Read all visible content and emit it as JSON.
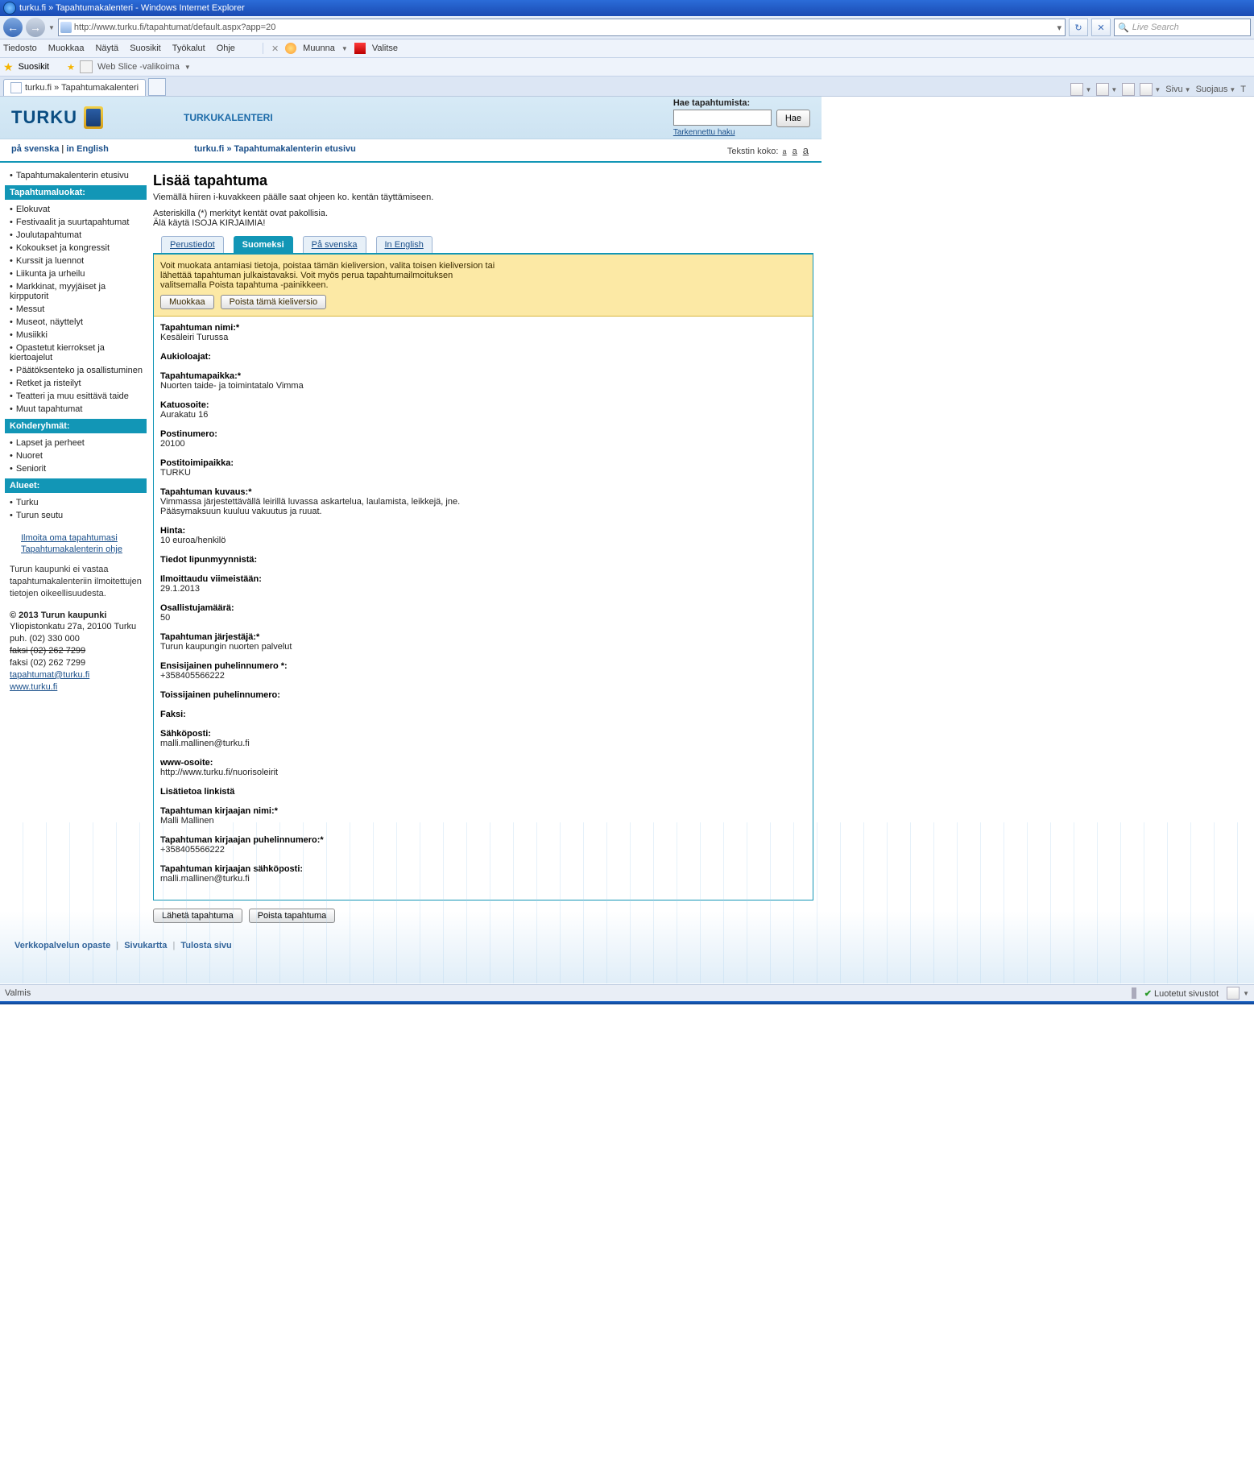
{
  "window": {
    "title": "turku.fi » Tapahtumakalenteri - Windows Internet Explorer",
    "url": "http://www.turku.fi/tapahtumat/default.aspx?app=20",
    "search_placeholder": "Live Search",
    "status_left": "Valmis",
    "status_trusted": "Luotetut sivustot"
  },
  "menus": {
    "items": [
      "Tiedosto",
      "Muokkaa",
      "Näytä",
      "Suosikit",
      "Työkalut",
      "Ohje"
    ],
    "muunna": "Muunna",
    "valitse": "Valitse",
    "favorites_label": "Suosikit",
    "webslice": "Web Slice -valikoima",
    "tab_label": "turku.fi » Tapahtumakalenteri",
    "tools": {
      "sivu": "Sivu",
      "suojaus": "Suojaus",
      "t": "T"
    }
  },
  "header": {
    "logo_text": "TURKU",
    "site_title": "TURKUKALENTERI",
    "search_label": "Hae tapahtumista:",
    "search_btn": "Hae",
    "adv_link": "Tarkennettu haku"
  },
  "subheader": {
    "lang_sv": "på svenska",
    "lang_en": "in English",
    "breadcrumb": "turku.fi » Tapahtumakalenterin etusivu",
    "text_size_label": "Tekstin koko:"
  },
  "sidebar": {
    "top_link": "Tapahtumakalenterin etusivu",
    "cat_head": "Tapahtumaluokat:",
    "cats": [
      "Elokuvat",
      "Festivaalit ja suurtapahtumat",
      "Joulutapahtumat",
      "Kokoukset ja kongressit",
      "Kurssit ja luennot",
      "Liikunta ja urheilu",
      "Markkinat, myyjäiset ja kirpputorit",
      "Messut",
      "Museot, näyttelyt",
      "Musiikki",
      "Opastetut kierrokset ja kiertoajelut",
      "Päätöksenteko ja osallistuminen",
      "Retket ja risteilyt",
      "Teatteri ja muu esittävä taide",
      "Muut tapahtumat"
    ],
    "grp_head": "Kohderyhmät:",
    "grps": [
      "Lapset ja perheet",
      "Nuoret",
      "Seniorit"
    ],
    "area_head": "Alueet:",
    "areas": [
      "Turku",
      "Turun seutu"
    ],
    "link1": "Ilmoita oma tapahtumasi",
    "link2": "Tapahtumakalenterin ohje",
    "disclaimer": "Turun kaupunki ei vastaa tapahtumakalenteriin ilmoitettujen tietojen oikeellisuudesta.",
    "copyright": "© 2013 Turun kaupunki",
    "addr": "Yliopistonkatu 27a, 20100 Turku",
    "tel": "puh. (02) 330 000",
    "fax1": "faksi (02) 262 7299",
    "fax2": "faksi (02) 262 7299",
    "email": "tapahtumat@turku.fi",
    "web": "www.turku.fi"
  },
  "main": {
    "h1": "Lisää tapahtuma",
    "intro1": "Viemällä hiiren i-kuvakkeen päälle saat ohjeen ko. kentän täyttämiseen.",
    "intro2": "Asteriskilla (*) merkityt kentät ovat pakollisia.",
    "intro3": "Älä käytä ISOJA KIRJAIMIA!",
    "tabs": {
      "t1": "Perustiedot",
      "t2": "Suomeksi",
      "t3": "På svenska",
      "t4": "In English"
    },
    "notice": {
      "line1": "Voit muokata antamiasi tietoja, poistaa tämän kieliversion, valita toisen kieliversion tai",
      "line2": "lähettää tapahtuman julkaistavaksi. Voit myös perua tapahtumailmoituksen",
      "line3": "valitsemalla Poista tapahtuma -painikkeen.",
      "btn_edit": "Muokkaa",
      "btn_del_lang": "Poista tämä kieliversio"
    },
    "fields": [
      {
        "label": "Tapahtuman nimi:*",
        "value": "Kesäleiri Turussa"
      },
      {
        "label": "Aukioloajat:",
        "value": ""
      },
      {
        "label": "Tapahtumapaikka:*",
        "value": "Nuorten taide- ja toimintatalo Vimma"
      },
      {
        "label": "Katuosoite:",
        "value": "Aurakatu 16"
      },
      {
        "label": "Postinumero:",
        "value": "20100"
      },
      {
        "label": "Postitoimipaikka:",
        "value": "TURKU"
      },
      {
        "label": "Tapahtuman kuvaus:*",
        "value": "Vimmassa järjestettävällä leirillä luvassa askartelua, laulamista, leikkejä, jne.\nPääsymaksuun kuuluu vakuutus ja ruuat."
      },
      {
        "label": "Hinta:",
        "value": "10 euroa/henkilö"
      },
      {
        "label": "Tiedot lipunmyynnistä:",
        "value": ""
      },
      {
        "label": "Ilmoittaudu viimeistään:",
        "value": "29.1.2013"
      },
      {
        "label": "Osallistujamäärä:",
        "value": "50"
      },
      {
        "label": "Tapahtuman järjestäjä:*",
        "value": "Turun kaupungin nuorten palvelut"
      },
      {
        "label": "Ensisijainen puhelinnumero *:",
        "value": "+358405566222"
      },
      {
        "label": "Toissijainen puhelinnumero:",
        "value": ""
      },
      {
        "label": "Faksi:",
        "value": ""
      },
      {
        "label": "Sähköposti:",
        "value": "malli.mallinen@turku.fi"
      },
      {
        "label": "www-osoite:",
        "value": "http://www.turku.fi/nuorisoleirit"
      },
      {
        "label": "Lisätietoa linkistä",
        "value": ""
      },
      {
        "label": "Tapahtuman kirjaajan nimi:*",
        "value": "Malli Mallinen"
      },
      {
        "label": "Tapahtuman kirjaajan puhelinnumero:*",
        "value": "+358405566222"
      },
      {
        "label": "Tapahtuman kirjaajan sähköposti:",
        "value": "malli.mallinen@turku.fi"
      }
    ],
    "submit": "Lähetä tapahtuma",
    "delete": "Poista tapahtuma"
  },
  "footer": {
    "l1": "Verkkopalvelun opaste",
    "l2": "Sivukartta",
    "l3": "Tulosta sivu"
  }
}
